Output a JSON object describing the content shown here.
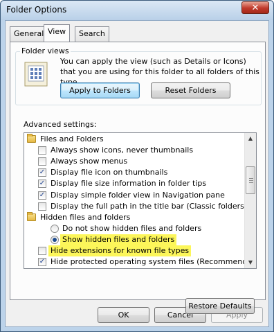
{
  "window": {
    "title": "Folder Options",
    "close_label": "✕"
  },
  "tabs": [
    {
      "label": "General",
      "active": false
    },
    {
      "label": "View",
      "active": true
    },
    {
      "label": "Search",
      "active": false
    }
  ],
  "folder_views": {
    "label": "Folder views",
    "description": "You can apply the view (such as Details or Icons) that you are using for this folder to all folders of this type.",
    "apply_button": "Apply to Folders",
    "reset_button": "Reset Folders",
    "icon": "folder-views-icon"
  },
  "advanced": {
    "label": "Advanced settings:",
    "items": [
      {
        "type": "folder",
        "label": "Files and Folders"
      },
      {
        "type": "checkbox",
        "label": "Always show icons, never thumbnails",
        "checked": false
      },
      {
        "type": "checkbox",
        "label": "Always show menus",
        "checked": false
      },
      {
        "type": "checkbox",
        "label": "Display file icon on thumbnails",
        "checked": true
      },
      {
        "type": "checkbox",
        "label": "Display file size information in folder tips",
        "checked": true
      },
      {
        "type": "checkbox",
        "label": "Display simple folder view in Navigation pane",
        "checked": true
      },
      {
        "type": "checkbox",
        "label": "Display the full path in the title bar (Classic folders only)",
        "checked": false
      },
      {
        "type": "folder",
        "label": "Hidden files and folders"
      },
      {
        "type": "radio",
        "label": "Do not show hidden files and folders",
        "checked": false
      },
      {
        "type": "radio",
        "label": "Show hidden files and folders",
        "checked": true,
        "highlighted": true
      },
      {
        "type": "checkbox",
        "label": "Hide extensions for known file types",
        "checked": false,
        "highlighted": true
      },
      {
        "type": "checkbox",
        "label": "Hide protected operating system files (Recommended)",
        "checked": true
      }
    ]
  },
  "restore_button": "Restore Defaults",
  "footer": {
    "ok": "OK",
    "cancel": "Cancel",
    "apply": "Apply"
  },
  "colors": {
    "highlight": "#fcf65a",
    "focus_border": "#3c7fb1"
  }
}
